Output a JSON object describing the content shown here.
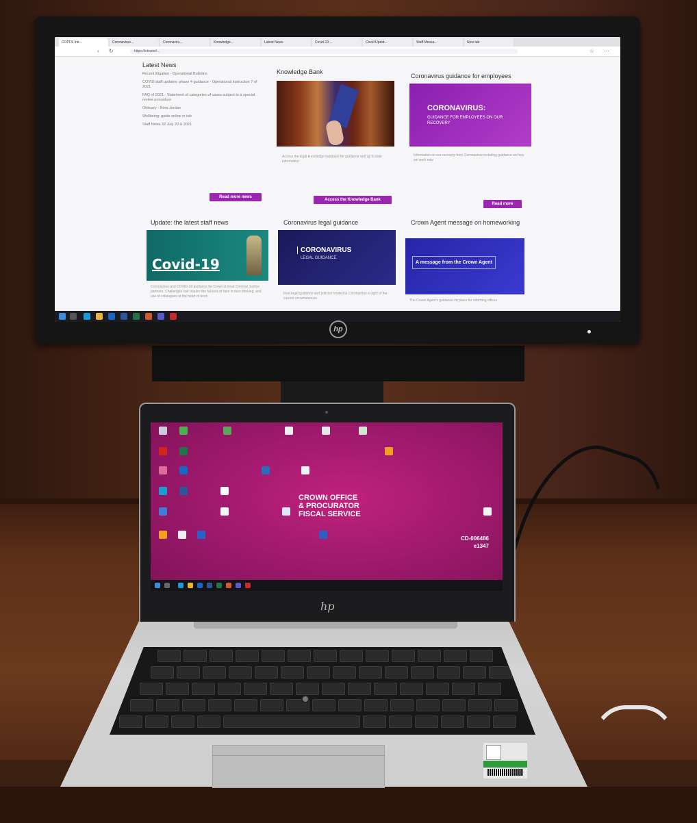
{
  "monitor": {
    "brand_logo": "hp",
    "browser": {
      "tabs": [
        "COPFS Intr...",
        "Coronavirus...",
        "Coronaviru...",
        "Knowledge...",
        "Latest News",
        "Covid-19 ...",
        "Covid Updat...",
        "Staff Messa...",
        "New tab"
      ],
      "address": "https://intranet/..."
    },
    "page": {
      "latest_news": {
        "title": "Latest News",
        "items": [
          "Recent litigation - Operational Bulletins",
          "COVID staff updates: phase 4 guidance - Operational instruction 7 of 2021",
          "FAQ of 2021 - Statement of categories of cases subject to a special review procedure",
          "Obituary - Nora Jordan",
          "Wellbeing: guide online in tab",
          "Staff News 32 July 20 & 2021"
        ],
        "button": "Read more news"
      },
      "knowledge_bank": {
        "title": "Knowledge Bank",
        "caption": "Access the legal knowledge database for guidance and up to date information",
        "button": "Access the Knowledge Bank"
      },
      "guidance_employees": {
        "title": "Coronavirus guidance for employees",
        "banner_heading": "CORONAVIRUS:",
        "banner_sub": "GUIDANCE FOR EMPLOYEES ON OUR RECOVERY",
        "caption": "Information on our recovery from Coronavirus including guidance on how we work now",
        "button": "Read more"
      },
      "staff_news": {
        "title": "Update: the latest staff news",
        "banner": "Covid-19",
        "caption": "Coronavirus and COVID-19 guidance for Crown & local Criminal Justice partners. Challenges can require the full lock of face to face thinking, and use of colleagues at the heart of work"
      },
      "legal_guidance": {
        "title": "Coronavirus legal guidance",
        "banner_heading": "CORONAVIRUS",
        "banner_sub": "LEGAL GUIDANCE",
        "caption": "Find legal guidance and policies related to Coronavirus in light of the current circumstances"
      },
      "crown_agent": {
        "title": "Crown Agent message on homeworking",
        "banner": "A message from the Crown Agent",
        "caption": "The Crown Agent's guidance on plans for returning offices"
      }
    }
  },
  "laptop": {
    "brand_logo": "hp",
    "desktop_labels": {
      "org_lines": [
        "CROWN OFFICE",
        "& PROCURATOR",
        "FISCAL SERVICE"
      ],
      "asset_lines": [
        "CD-006486",
        "e1347"
      ]
    }
  },
  "colors": {
    "brand_purple": "#9b27b0",
    "desktop_magenta": "#b0206f"
  }
}
